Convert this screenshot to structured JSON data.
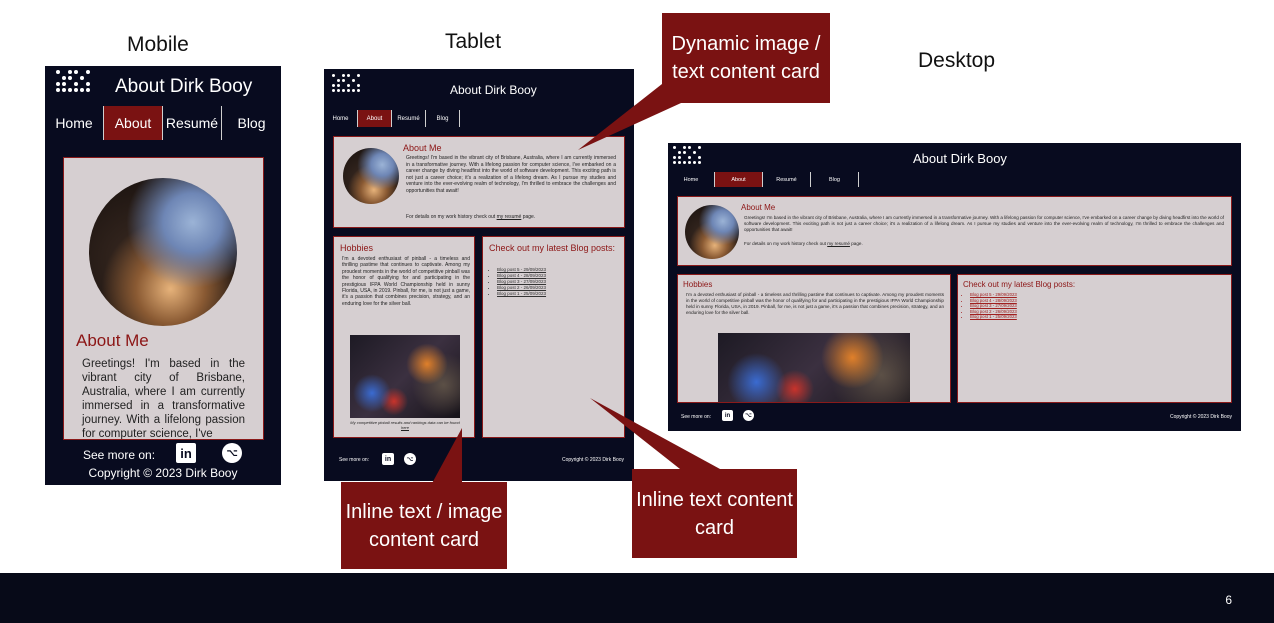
{
  "labels": {
    "mobile": "Mobile",
    "tablet": "Tablet",
    "desktop": "Desktop"
  },
  "site": {
    "title": "About Dirk Booy",
    "nav": [
      "Home",
      "About",
      "Resumé",
      "Blog"
    ],
    "about_heading": "About Me",
    "about_text": "Greetings! I'm based in the vibrant city of Brisbane, Australia, where I am currently immersed in a transformative journey. With a lifelong passion for computer science, I've embarked on a career change by diving headfirst into the world of software development. This exciting path is not just a career choice; it's a realization of a lifelong dream. As I pursue my studies and venture into the ever-evolving realm of technology, I'm thrilled to embrace the challenges and opportunities that await!",
    "about_text_mobile": "Greetings! I'm based in the vibrant city of Brisbane, Australia, where I am currently immersed in a transformative journey. With a lifelong passion for computer science, I've",
    "details_prefix": "For details on my work history check out ",
    "details_link": "my resumé",
    "details_suffix": " page.",
    "hobbies_heading": "Hobbies",
    "hobbies_text": "I'm a devoted enthusiast of pinball - a timeless and thrilling pastime that continues to captivate. Among my proudest moments in the world of competitive pinball was the honor of qualifying for and participating in the prestigious IFPA World Championship held in sunny Florida, USA, in 2019. Pinball, for me, is not just a game, it's a passion that combines precision, strategy, and an enduring love for the silver ball.",
    "image_caption_prefix": "My competitive pinball results and rankings data can be found ",
    "image_caption_link": "here",
    "blog_heading": "Check out my latest Blog posts:",
    "blog_posts": [
      "Blog post 5 - 29/09/2023",
      "Blog post 4 - 28/09/2023",
      "Blog post 3 - 27/09/2023",
      "Blog post 2 - 26/09/2023",
      "Blog post 1 - 25/09/2023"
    ],
    "see_more": "See more on:",
    "copyright": "Copyright © 2023 Dirk Booy"
  },
  "callouts": {
    "dynamic": "Dynamic image / text content card",
    "inline_image": "Inline text / image content card",
    "inline_text": "Inline text content card"
  },
  "slide_number": "6",
  "icons": {
    "linkedin": "linkedin-icon",
    "github": "github-icon"
  },
  "colors": {
    "site_bg": "#080b1f",
    "accent": "#7a1212",
    "card_bg": "#d6cfd1",
    "heading": "#8c1515"
  }
}
